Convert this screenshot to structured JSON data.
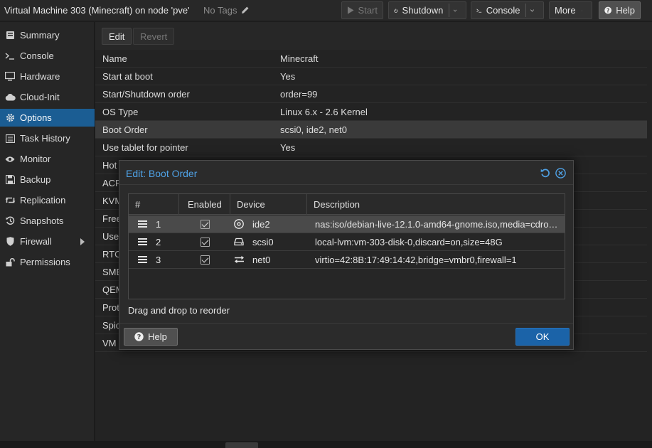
{
  "header": {
    "vm_title": "Virtual Machine 303 (Minecraft) on node 'pve'",
    "tags_label": "No Tags",
    "buttons": {
      "start": "Start",
      "shutdown": "Shutdown",
      "console": "Console",
      "more": "More",
      "help": "Help"
    }
  },
  "sidebar": {
    "items": [
      {
        "label": "Summary",
        "icon": "book-icon"
      },
      {
        "label": "Console",
        "icon": "terminal-icon"
      },
      {
        "label": "Hardware",
        "icon": "monitor-icon"
      },
      {
        "label": "Cloud-Init",
        "icon": "cloud-icon"
      },
      {
        "label": "Options",
        "icon": "gear-icon"
      },
      {
        "label": "Task History",
        "icon": "list-icon"
      },
      {
        "label": "Monitor",
        "icon": "eye-icon"
      },
      {
        "label": "Backup",
        "icon": "floppy-icon"
      },
      {
        "label": "Replication",
        "icon": "retweet-icon"
      },
      {
        "label": "Snapshots",
        "icon": "history-icon"
      },
      {
        "label": "Firewall",
        "icon": "shield-icon"
      },
      {
        "label": "Permissions",
        "icon": "unlock-icon"
      }
    ]
  },
  "toolbar": {
    "edit": "Edit",
    "revert": "Revert"
  },
  "options": [
    {
      "key": "Name",
      "value": "Minecraft"
    },
    {
      "key": "Start at boot",
      "value": "Yes"
    },
    {
      "key": "Start/Shutdown order",
      "value": "order=99"
    },
    {
      "key": "OS Type",
      "value": "Linux 6.x - 2.6 Kernel"
    },
    {
      "key": "Boot Order",
      "value": "scsi0, ide2, net0"
    },
    {
      "key": "Use tablet for pointer",
      "value": "Yes"
    },
    {
      "key": "Hot",
      "value": ""
    },
    {
      "key": "ACP",
      "value": ""
    },
    {
      "key": "KVM",
      "value": ""
    },
    {
      "key": "Free",
      "value": ""
    },
    {
      "key": "Use",
      "value": ""
    },
    {
      "key": "RTC",
      "value": ""
    },
    {
      "key": "SME",
      "value": ""
    },
    {
      "key": "QEM",
      "value": ""
    },
    {
      "key": "Prot",
      "value": ""
    },
    {
      "key": "Spic",
      "value": ""
    },
    {
      "key": "VM",
      "value": ""
    }
  ],
  "dialog": {
    "title": "Edit: Boot Order",
    "columns": [
      "#",
      "Enabled",
      "Device",
      "Description"
    ],
    "rows": [
      {
        "num": "1",
        "enabled": true,
        "device": "ide2",
        "device_icon": "cdrom-icon",
        "description": "nas:iso/debian-live-12.1.0-amd64-gnome.iso,media=cdro…"
      },
      {
        "num": "2",
        "enabled": true,
        "device": "scsi0",
        "device_icon": "hdd-icon",
        "description": "local-lvm:vm-303-disk-0,discard=on,size=48G"
      },
      {
        "num": "3",
        "enabled": true,
        "device": "net0",
        "device_icon": "exchange-icon",
        "description": "virtio=42:8B:17:49:14:42,bridge=vmbr0,firewall=1"
      }
    ],
    "hint": "Drag and drop to reorder",
    "help": "Help",
    "ok": "OK"
  }
}
